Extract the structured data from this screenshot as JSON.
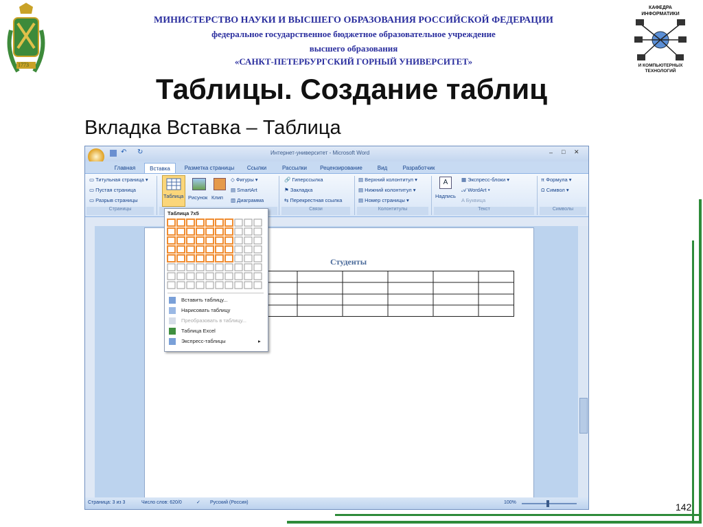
{
  "header": {
    "line1": "МИНИСТЕРСТВО НАУКИ И ВЫСШЕГО ОБРАЗОВАНИЯ РОССИЙСКОЙ ФЕДЕРАЦИИ",
    "line2": "федеральное государственное бюджетное образовательное учреждение",
    "line3": "высшего образования",
    "line4": "«САНКТ-ПЕТЕРБУРГСКИЙ ГОРНЫЙ УНИВЕРСИТЕТ»",
    "dept_top": "КАФЕДРА ИНФОРМАТИКИ",
    "dept_bottom": "И КОМПЬЮТЕРНЫХ ТЕХНОЛОГИЙ",
    "emblem_year": "1773"
  },
  "slide": {
    "title": "Таблицы. Создание таблиц",
    "subtitle": "Вкладка Вставка – Таблица",
    "page_number": "142"
  },
  "word": {
    "window_title": "Интернет-университет - Microsoft Word",
    "tabs": [
      "Главная",
      "Вставка",
      "Разметка страницы",
      "Ссылки",
      "Рассылки",
      "Рецензирование",
      "Вид",
      "Разработчик"
    ],
    "active_tab": "Вставка",
    "ribbon": {
      "pages": [
        "Титульная страница",
        "Пустая страница",
        "Разрыв страницы"
      ],
      "pages_group": "Страницы",
      "table_button": "Таблица",
      "illustrations": [
        "Рисунок",
        "Клип"
      ],
      "shapes": [
        "Фигуры",
        "SmartArt",
        "Диаграмма"
      ],
      "links": [
        "Гиперссылка",
        "Закладка",
        "Перекрестная ссылка"
      ],
      "links_group": "Связи",
      "headers": [
        "Верхний колонтитул",
        "Нижний колонтитул",
        "Номер страницы"
      ],
      "headers_group": "Колонтитулы",
      "textbox": "Надпись",
      "text": [
        "Экспресс-блоки",
        "WordArt",
        "Буквица"
      ],
      "text_group": "Текст",
      "symbols": [
        "Формула",
        "Символ"
      ],
      "symbols_group": "Символы"
    },
    "dropdown": {
      "header": "Таблица 7x5",
      "items": [
        {
          "label": "Вставить таблицу...",
          "enabled": true
        },
        {
          "label": "Нарисовать таблицу",
          "enabled": true
        },
        {
          "label": "Преобразовать в таблицу...",
          "enabled": false
        },
        {
          "label": "Таблица Excel",
          "enabled": true
        },
        {
          "label": "Экспресс-таблицы",
          "enabled": true
        }
      ]
    },
    "document": {
      "table_caption": "Студенты"
    },
    "status": {
      "page": "Страница: 3 из 3",
      "words": "Число слов: 620/0",
      "language": "Русский (Россия)",
      "zoom": "100%"
    }
  },
  "colors": {
    "header_text": "#2a2e9e",
    "accent_green": "#2e8b3a",
    "grid_highlight": "#f08c30"
  }
}
